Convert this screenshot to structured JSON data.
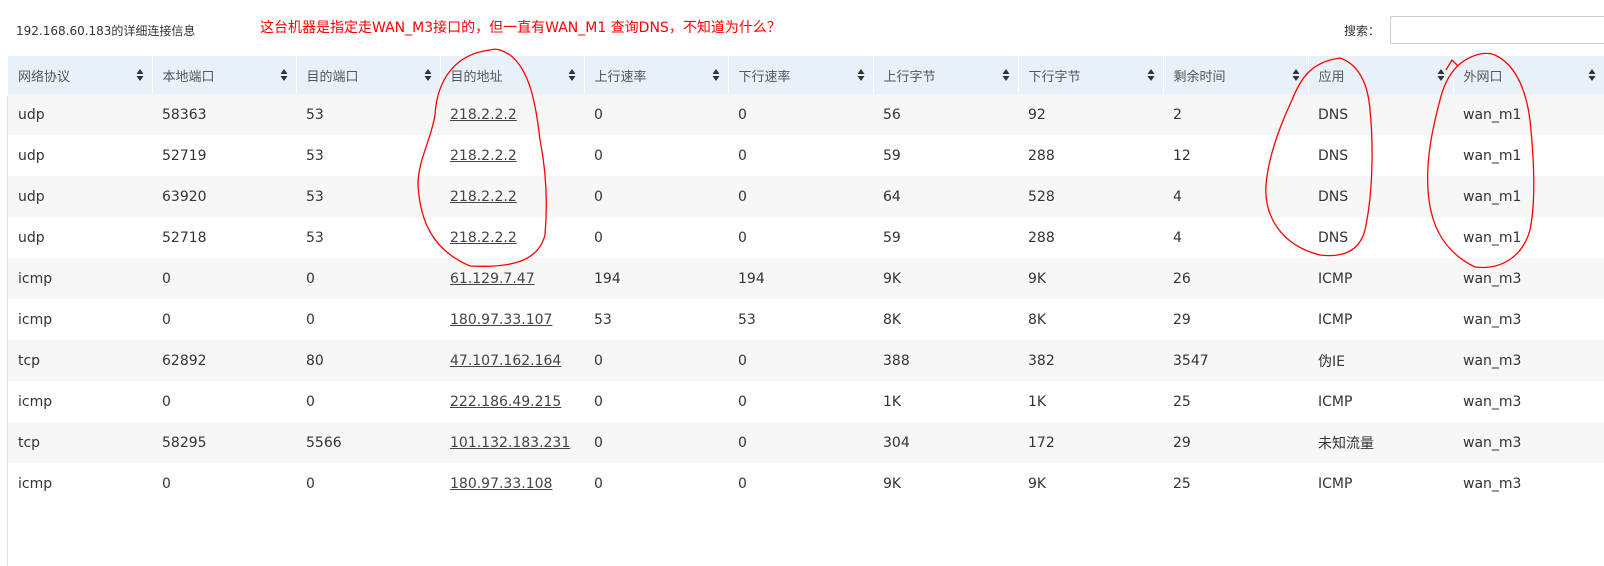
{
  "page": {
    "title": "192.168.60.183的详细连接信息",
    "annotation": "这台机器是指定走WAN_M3接口的，但一直有WAN_M1 查询DNS，不知道为什么？",
    "search_label": "搜索：",
    "search_value": "",
    "search_placeholder": ""
  },
  "colors": {
    "header_bg": "#e8f1f9",
    "row_odd": "#f7f7f7",
    "annotation": "#ff0000"
  },
  "table": {
    "columns": [
      "网络协议",
      "本地端口",
      "目的端口",
      "目的地址",
      "上行速率",
      "下行速率",
      "上行字节",
      "下行字节",
      "剩余时间",
      "应用",
      "外网口"
    ],
    "rows": [
      [
        "udp",
        "58363",
        "53",
        "218.2.2.2",
        "0",
        "0",
        "56",
        "92",
        "2",
        "DNS",
        "wan_m1"
      ],
      [
        "udp",
        "52719",
        "53",
        "218.2.2.2",
        "0",
        "0",
        "59",
        "288",
        "12",
        "DNS",
        "wan_m1"
      ],
      [
        "udp",
        "63920",
        "53",
        "218.2.2.2",
        "0",
        "0",
        "64",
        "528",
        "4",
        "DNS",
        "wan_m1"
      ],
      [
        "udp",
        "52718",
        "53",
        "218.2.2.2",
        "0",
        "0",
        "59",
        "288",
        "4",
        "DNS",
        "wan_m1"
      ],
      [
        "icmp",
        "0",
        "0",
        "61.129.7.47",
        "194",
        "194",
        "9K",
        "9K",
        "26",
        "ICMP",
        "wan_m3"
      ],
      [
        "icmp",
        "0",
        "0",
        "180.97.33.107",
        "53",
        "53",
        "8K",
        "8K",
        "29",
        "ICMP",
        "wan_m3"
      ],
      [
        "tcp",
        "62892",
        "80",
        "47.107.162.164",
        "0",
        "0",
        "388",
        "382",
        "3547",
        "伪IE",
        "wan_m3"
      ],
      [
        "icmp",
        "0",
        "0",
        "222.186.49.215",
        "0",
        "0",
        "1K",
        "1K",
        "25",
        "ICMP",
        "wan_m3"
      ],
      [
        "tcp",
        "58295",
        "5566",
        "101.132.183.231",
        "0",
        "0",
        "304",
        "172",
        "29",
        "未知流量",
        "wan_m3"
      ],
      [
        "icmp",
        "0",
        "0",
        "180.97.33.108",
        "0",
        "0",
        "9K",
        "9K",
        "25",
        "ICMP",
        "wan_m3"
      ]
    ]
  }
}
